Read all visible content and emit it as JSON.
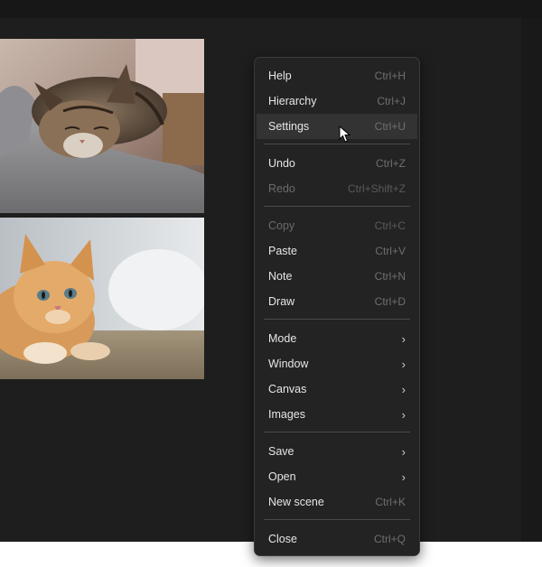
{
  "menu": {
    "items": [
      {
        "label": "Help",
        "shortcut": "Ctrl+H"
      },
      {
        "label": "Hierarchy",
        "shortcut": "Ctrl+J"
      },
      {
        "label": "Settings",
        "shortcut": "Ctrl+U",
        "state": "hovered"
      },
      {
        "label": "Undo",
        "shortcut": "Ctrl+Z"
      },
      {
        "label": "Redo",
        "shortcut": "Ctrl+Shift+Z",
        "state": "disabled"
      },
      {
        "label": "Copy",
        "shortcut": "Ctrl+C",
        "state": "disabled"
      },
      {
        "label": "Paste",
        "shortcut": "Ctrl+V"
      },
      {
        "label": "Note",
        "shortcut": "Ctrl+N"
      },
      {
        "label": "Draw",
        "shortcut": "Ctrl+D"
      },
      {
        "label": "Mode",
        "submenu": true
      },
      {
        "label": "Window",
        "submenu": true
      },
      {
        "label": "Canvas",
        "submenu": true
      },
      {
        "label": "Images",
        "submenu": true
      },
      {
        "label": "Save",
        "submenu": true
      },
      {
        "label": "Open",
        "submenu": true
      },
      {
        "label": "New scene",
        "shortcut": "Ctrl+K"
      },
      {
        "label": "Close",
        "shortcut": "Ctrl+Q"
      }
    ],
    "submenu_icon": "chevron-right-icon"
  },
  "canvas": {
    "images": [
      "sleeping-tabby-kitten-photo",
      "orange-kitten-photo"
    ]
  },
  "colors": {
    "app_background": "#1b1b1b",
    "menu_background": "#232323",
    "hover_background": "#333333",
    "text": "#e6e6e6",
    "shortcut_text": "#6f6f6f",
    "disabled_text": "#6b6b6b"
  }
}
